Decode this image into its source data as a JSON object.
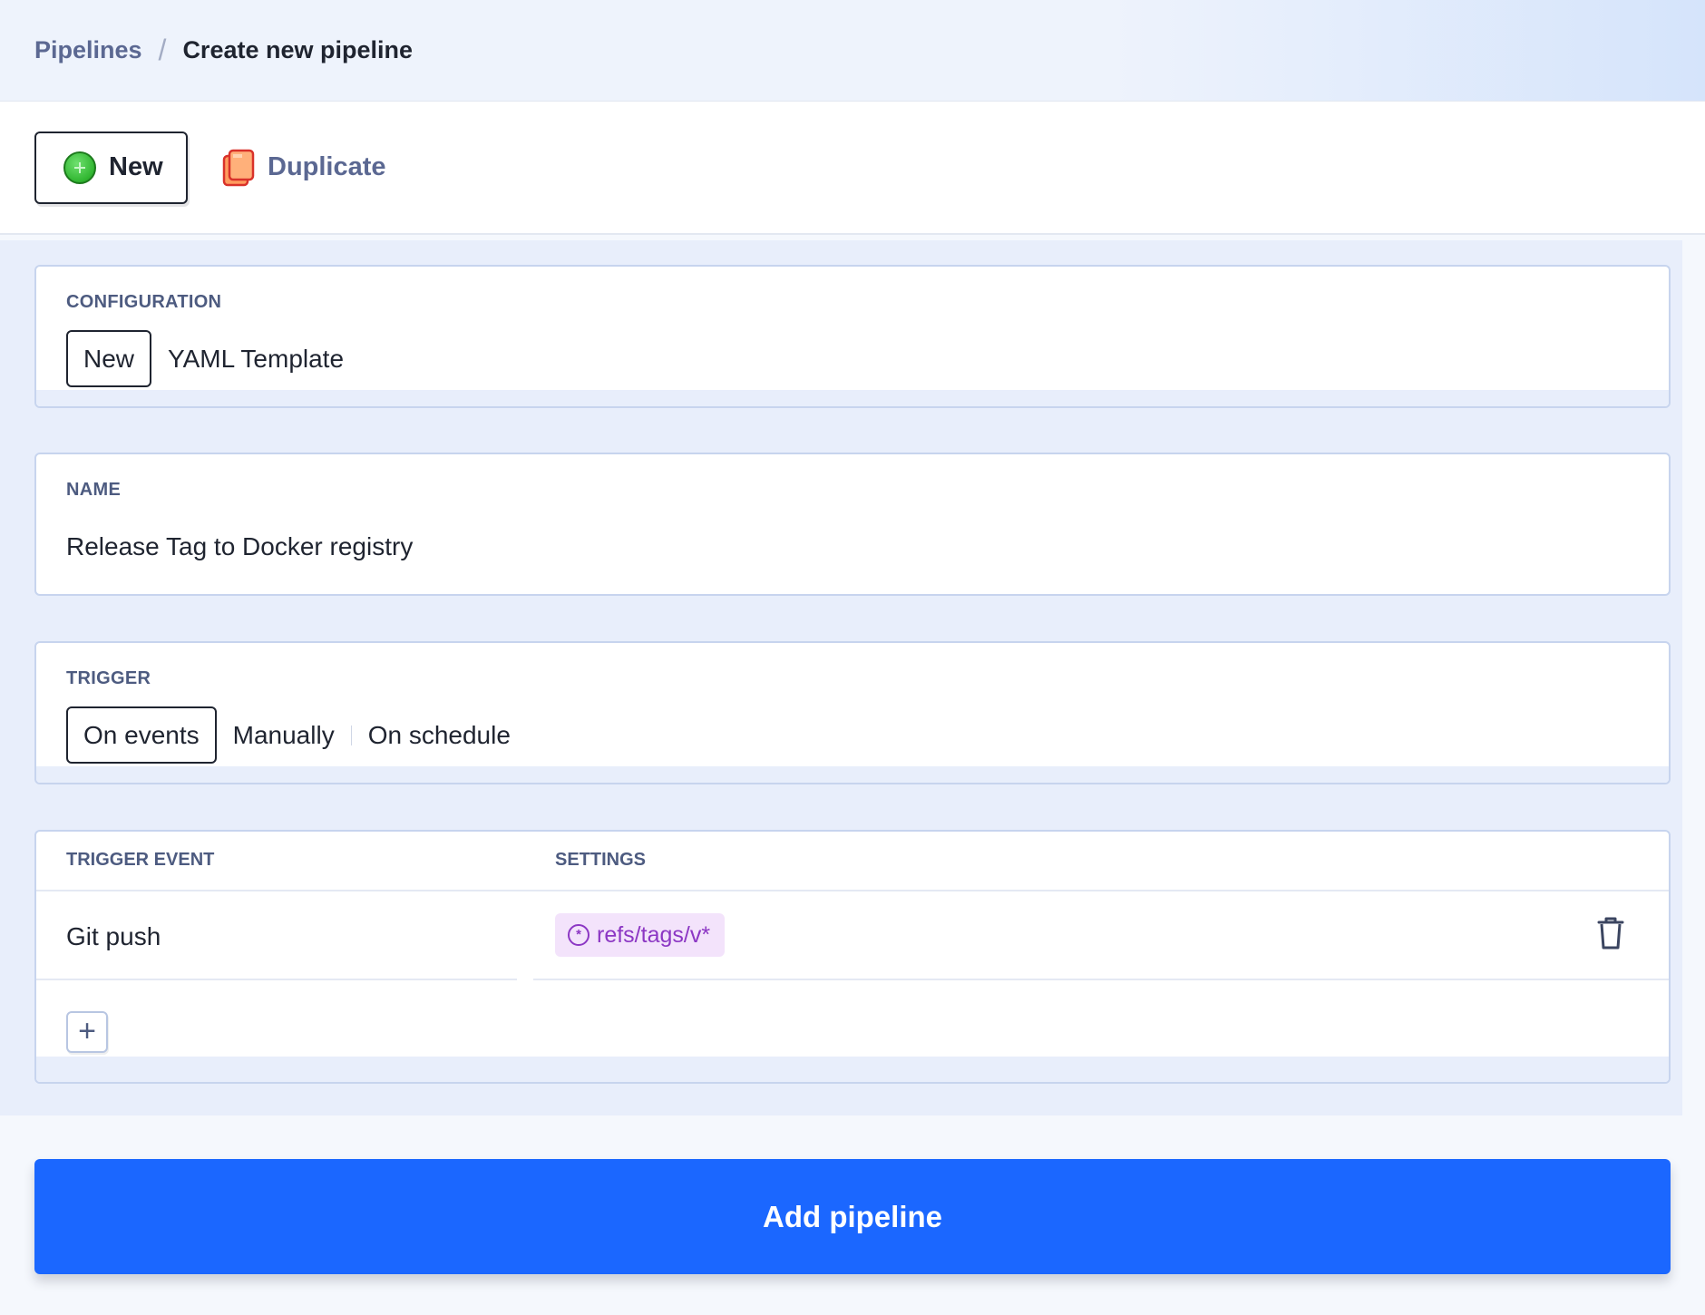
{
  "breadcrumb": {
    "parent": "Pipelines",
    "separator": "/",
    "current": "Create new pipeline"
  },
  "toolbar": {
    "new_label": "New",
    "duplicate_label": "Duplicate"
  },
  "configuration": {
    "label": "CONFIGURATION",
    "options": [
      "New",
      "YAML Template"
    ],
    "selected": "New"
  },
  "name": {
    "label": "NAME",
    "value": "Release Tag to Docker registry"
  },
  "trigger": {
    "label": "TRIGGER",
    "options": [
      "On events",
      "Manually",
      "On schedule"
    ],
    "selected": "On events"
  },
  "trigger_events": {
    "columns": [
      "TRIGGER EVENT",
      "SETTINGS"
    ],
    "rows": [
      {
        "event": "Git push",
        "setting": "refs/tags/v*"
      }
    ],
    "add_label": "+"
  },
  "submit": {
    "label": "Add pipeline"
  },
  "colors": {
    "primary": "#1b67ff",
    "tag_bg": "#f3e3fb",
    "tag_text": "#8c37c4"
  }
}
